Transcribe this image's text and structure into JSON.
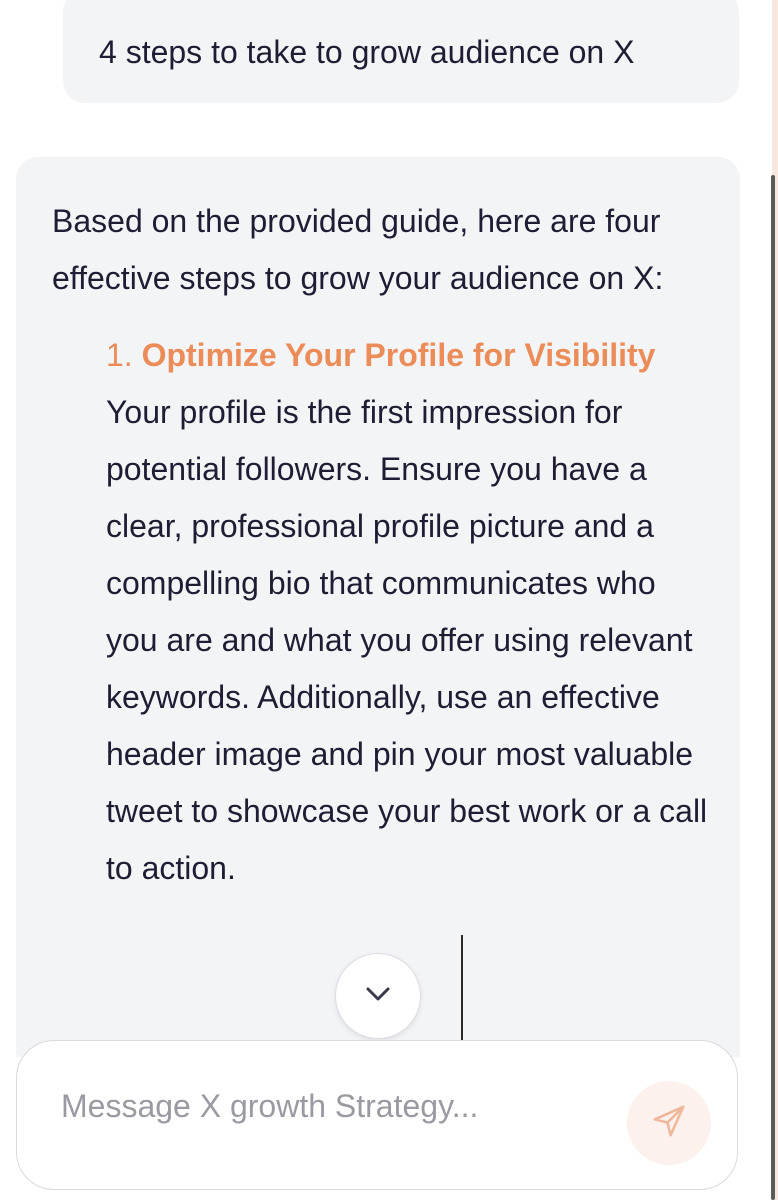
{
  "user_message": {
    "text": "4 steps to take to grow audience on X"
  },
  "assistant_message": {
    "intro": "Based on the provided guide, here are four effective steps to grow your audience on X:",
    "steps": [
      {
        "number": "1.",
        "title": "Optimize Your Profile for Visibility",
        "body": "Your profile is the first impression for potential followers. Ensure you have a clear, professional profile picture and a compelling bio that communicates who you are and what you offer using relevant keywords. Additionally, use an effective header image and pin your most valuable tweet to showcase your best work or a call to action."
      }
    ]
  },
  "composer": {
    "placeholder": "Message X growth Strategy..."
  },
  "icons": {
    "scroll_down": "chevron-down-icon",
    "send": "send-icon"
  },
  "colors": {
    "accent": "#ec8c58",
    "bubble_bg": "#f3f4f6",
    "text": "#1f1d33",
    "placeholder": "#9a9aa3"
  }
}
